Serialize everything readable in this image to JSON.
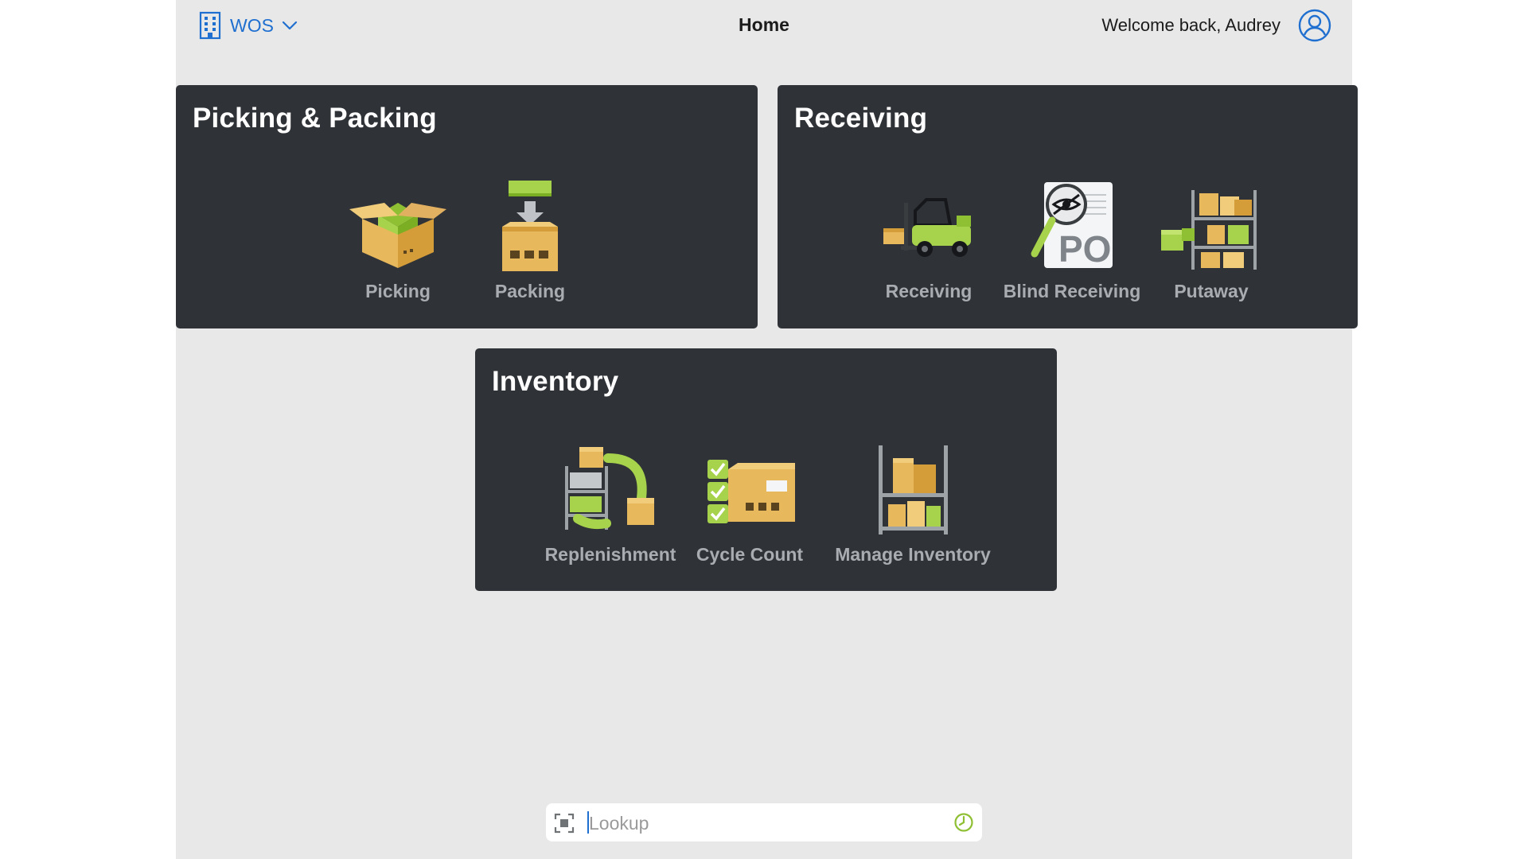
{
  "header": {
    "site_name": "WOS",
    "title": "Home",
    "welcome": "Welcome back, Audrey"
  },
  "sections": {
    "picking": {
      "title": "Picking & Packing",
      "tiles": [
        {
          "label": "Picking",
          "icon": "open-box-icon"
        },
        {
          "label": "Packing",
          "icon": "packing-box-icon"
        }
      ]
    },
    "receiving": {
      "title": "Receiving",
      "tiles": [
        {
          "label": "Receiving",
          "icon": "forklift-icon"
        },
        {
          "label": "Blind Receiving",
          "icon": "blind-po-icon"
        },
        {
          "label": "Putaway",
          "icon": "putaway-shelf-icon"
        }
      ]
    },
    "inventory": {
      "title": "Inventory",
      "tiles": [
        {
          "label": "Replenishment",
          "icon": "replenishment-icon"
        },
        {
          "label": "Cycle Count",
          "icon": "cycle-count-icon"
        },
        {
          "label": "Manage Inventory",
          "icon": "shelf-boxes-icon"
        }
      ]
    }
  },
  "lookup": {
    "placeholder": "Lookup"
  },
  "colors": {
    "accent": "#1f6fd0",
    "panel": "#2f3236",
    "background": "#e8e8e8",
    "icon_green": "#a6d34b",
    "icon_cardboard": "#e8b85c"
  }
}
